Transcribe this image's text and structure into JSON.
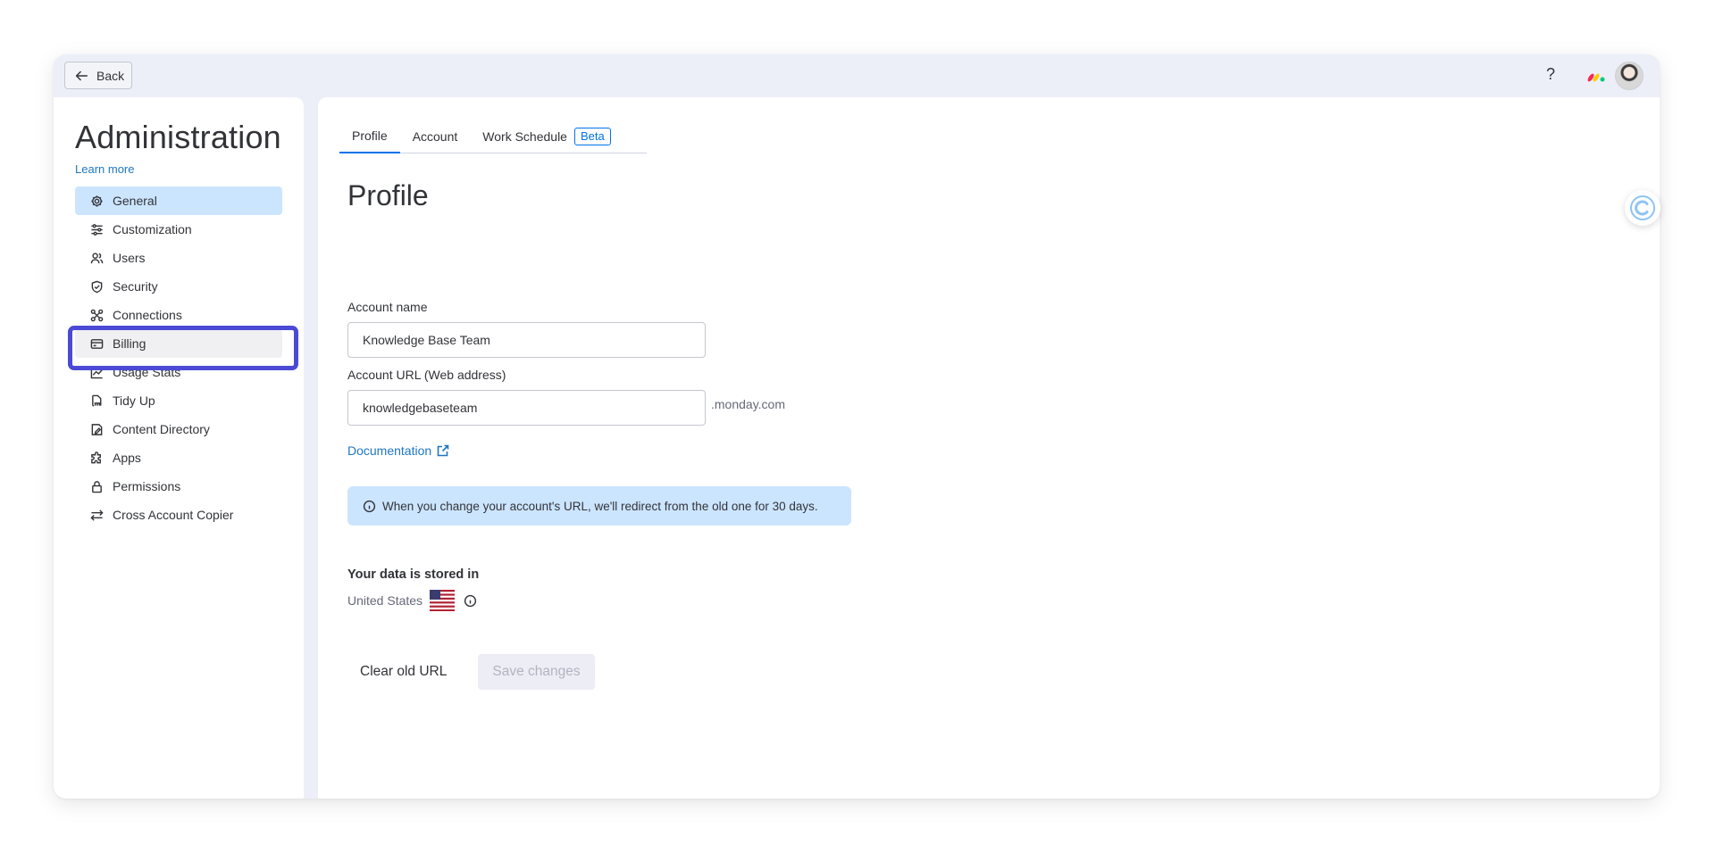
{
  "topbar": {
    "back_label": "Back",
    "help_label": "?",
    "icons": {
      "back": "arrow-left-icon",
      "help": "question-mark-icon",
      "logo": "monday-logo-icon",
      "avatar": "user-avatar"
    }
  },
  "sidebar": {
    "title": "Administration",
    "learn_more": "Learn more",
    "items": [
      {
        "label": "General",
        "icon": "gear-icon",
        "state": "active"
      },
      {
        "label": "Customization",
        "icon": "sliders-icon"
      },
      {
        "label": "Users",
        "icon": "users-icon"
      },
      {
        "label": "Security",
        "icon": "shield-icon"
      },
      {
        "label": "Connections",
        "icon": "connections-icon"
      },
      {
        "label": "Billing",
        "icon": "credit-card-icon",
        "state": "highlighted"
      },
      {
        "label": "Usage Stats",
        "icon": "chart-line-icon"
      },
      {
        "label": "Tidy Up",
        "icon": "broom-icon"
      },
      {
        "label": "Content Directory",
        "icon": "document-icon"
      },
      {
        "label": "Apps",
        "icon": "puzzle-icon"
      },
      {
        "label": "Permissions",
        "icon": "lock-icon"
      },
      {
        "label": "Cross Account Copier",
        "icon": "swap-arrows-icon"
      }
    ]
  },
  "main": {
    "tabs": [
      {
        "label": "Profile",
        "active": true
      },
      {
        "label": "Account"
      },
      {
        "label": "Work Schedule",
        "badge": "Beta"
      }
    ],
    "title": "Profile",
    "account_name": {
      "label": "Account name",
      "value": "Knowledge Base Team"
    },
    "account_url": {
      "label": "Account URL (Web address)",
      "value": "knowledgebaseteam",
      "suffix": ".monday.com"
    },
    "documentation_link": "Documentation",
    "info_banner": "When you change your account's URL, we'll redirect from the old one for 30 days.",
    "data_storage": {
      "heading": "Your data is stored in",
      "country": "United States"
    },
    "buttons": {
      "clear": "Clear old URL",
      "save": "Save changes"
    }
  },
  "colors": {
    "accent": "#0073ea",
    "active_nav_bg": "#cce5ff",
    "highlight_border": "#4a4ad6",
    "link": "#1f76c2",
    "banner_bg": "#cce5ff"
  }
}
